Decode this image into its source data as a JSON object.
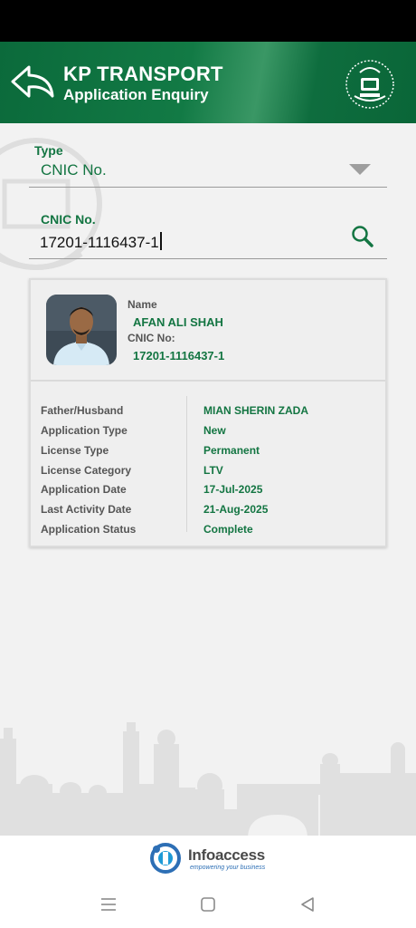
{
  "header": {
    "title": "KP TRANSPORT",
    "subtitle": "Application Enquiry",
    "color": "#0e6d3e"
  },
  "form": {
    "type_label": "Type",
    "type_value": "CNIC No.",
    "cnic_label": "CNIC No.",
    "cnic_value": "17201-1116437-1"
  },
  "card": {
    "name_label": "Name",
    "name_value": "AFAN ALI SHAH",
    "cnic_label": "CNIC No:",
    "cnic_value": "17201-1116437-1",
    "details": [
      {
        "label": "Father/Husband",
        "value": "MIAN SHERIN ZADA"
      },
      {
        "label": "Application Type",
        "value": "New"
      },
      {
        "label": "License Type",
        "value": "Permanent"
      },
      {
        "label": "License Category",
        "value": "LTV"
      },
      {
        "label": "Application Date",
        "value": "17-Jul-2025"
      },
      {
        "label": "Last Activity Date",
        "value": "21-Aug-2025"
      },
      {
        "label": "Application Status",
        "value": "Complete"
      }
    ]
  },
  "footer": {
    "brand": "Infoaccess",
    "tagline": "empowering your business"
  },
  "icons": [
    "back-arrow-icon",
    "kp-emblem-icon",
    "dropdown-arrow-icon",
    "search-icon",
    "menu-icon",
    "home-icon",
    "back-triangle-icon"
  ],
  "accent_color": "#137542"
}
